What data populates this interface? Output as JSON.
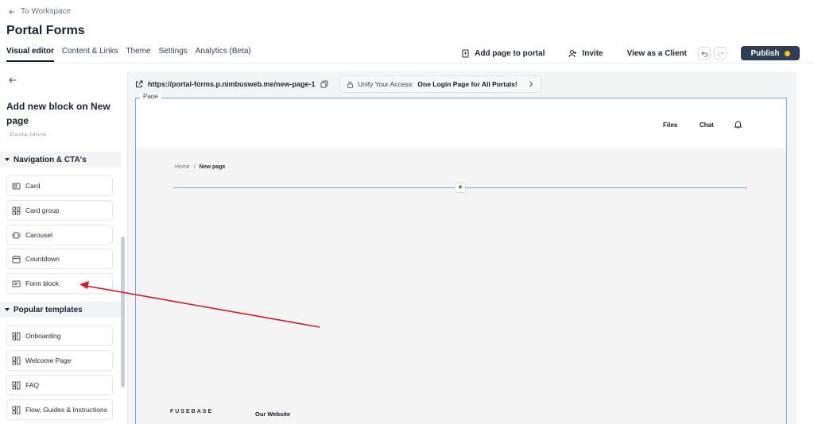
{
  "header": {
    "back_label": "To Workspace",
    "title": "Portal Forms",
    "tabs": [
      {
        "label": "Visual editor",
        "active": true
      },
      {
        "label": "Content & Links"
      },
      {
        "label": "Theme"
      },
      {
        "label": "Settings"
      },
      {
        "label": "Analytics (Beta)"
      }
    ],
    "actions": {
      "add_page": "Add page to portal",
      "invite": "Invite",
      "view_client": "View as a Client",
      "publish": "Publish"
    }
  },
  "sidebar": {
    "title": "Add new block on New page",
    "cut_item": "Paste block",
    "sections": [
      {
        "label": "Navigation & CTA's",
        "items": [
          {
            "label": "Card",
            "icon": "card-icon"
          },
          {
            "label": "Card group",
            "icon": "grid-icon"
          },
          {
            "label": "Carousel",
            "icon": "carousel-icon"
          },
          {
            "label": "Countdown",
            "icon": "calendar-icon"
          },
          {
            "label": "Form block",
            "icon": "form-icon"
          }
        ]
      },
      {
        "label": "Popular templates",
        "items": [
          {
            "label": "Onboarding",
            "icon": "template-icon"
          },
          {
            "label": "Welcome Page",
            "icon": "template-icon"
          },
          {
            "label": "FAQ",
            "icon": "template-icon"
          },
          {
            "label": "Flow, Guides & Instructions",
            "icon": "template-icon"
          }
        ]
      }
    ]
  },
  "canvas": {
    "url": "https://portal-forms.p.nimbusweb.me/new-page-1",
    "unify_prefix": "Unify Your Access:",
    "unify_bold": "One Login Page for All Portals!",
    "page_tag": "Page",
    "nav": {
      "files": "Files",
      "chat": "Chat"
    },
    "breadcrumb": {
      "home": "Home",
      "sep": "/",
      "current": "New page"
    },
    "plus": "+",
    "footer": {
      "logo": "FUSEBASE",
      "link": "Our Website"
    }
  },
  "colors": {
    "publish_bg": "#2f3e54",
    "publish_dot": "#f5c518",
    "selection_blue": "#7aa6e0",
    "annotation_arrow": "#d0192b"
  }
}
